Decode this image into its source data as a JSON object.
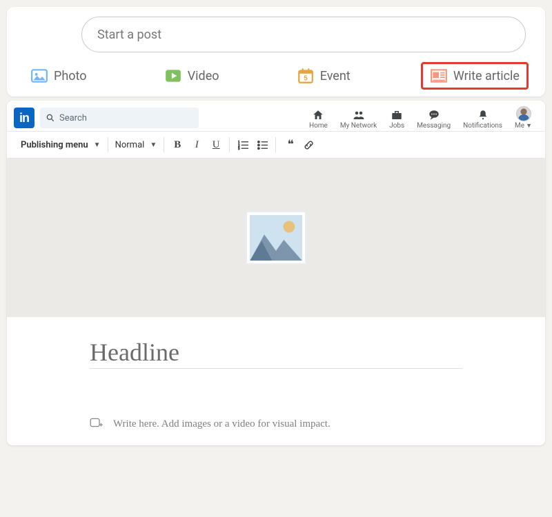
{
  "post_box": {
    "placeholder": "Start a post",
    "actions": {
      "photo": "Photo",
      "video": "Video",
      "event": "Event",
      "article": "Write article",
      "event_day": "5"
    }
  },
  "nav": {
    "logo_text": "in",
    "search_placeholder": "Search",
    "items": {
      "home": "Home",
      "network": "My Network",
      "jobs": "Jobs",
      "messaging": "Messaging",
      "notifications": "Notifications",
      "me": "Me"
    }
  },
  "toolbar": {
    "publishing_menu": "Publishing menu",
    "style_select": "Normal",
    "bold": "B",
    "italic": "I",
    "underline": "U",
    "quote": "❝"
  },
  "article": {
    "headline_placeholder": "Headline",
    "body_placeholder": "Write here. Add images or a video for visual impact."
  }
}
